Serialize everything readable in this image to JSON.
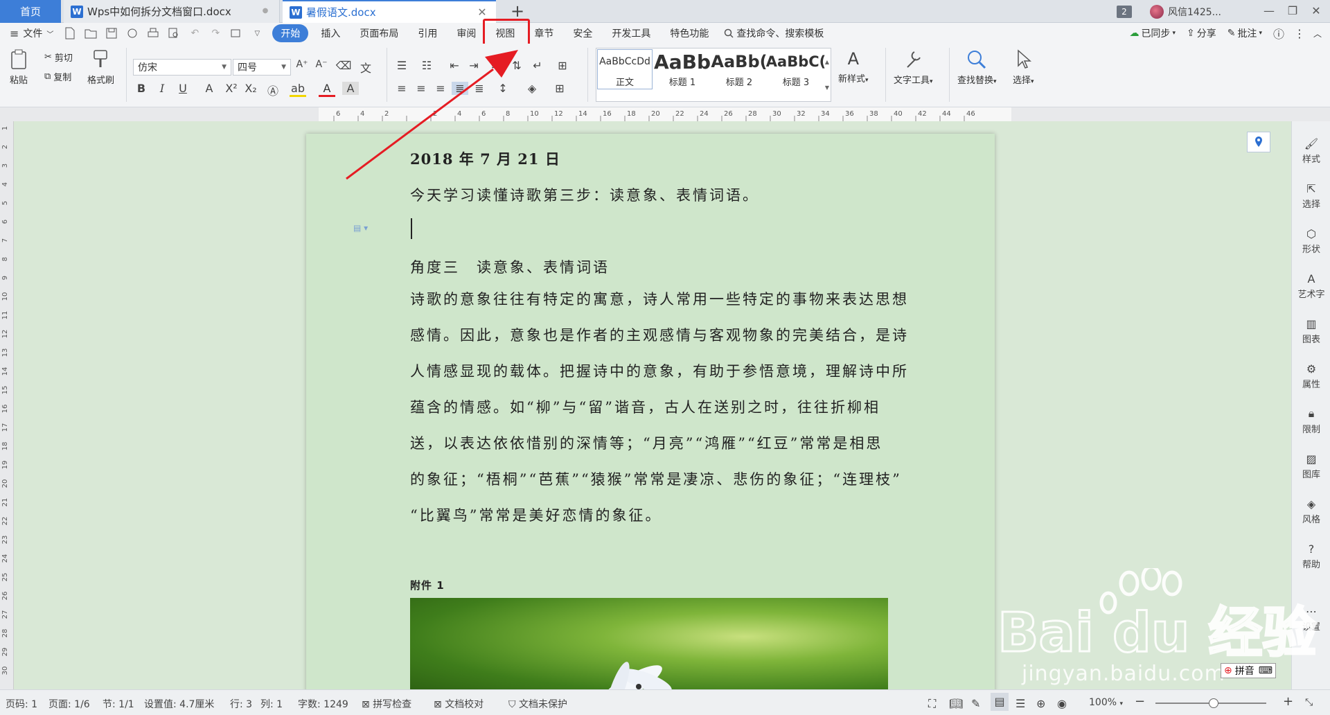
{
  "tabs": {
    "home": "首页",
    "doc1": "Wps中如何拆分文档窗口.docx",
    "doc2": "暑假语文.docx",
    "new": "+",
    "window_count": "2",
    "user": "风信1425..."
  },
  "menu": {
    "file": "文件",
    "tabs": [
      "开始",
      "插入",
      "页面布局",
      "引用",
      "审阅",
      "视图",
      "章节",
      "安全",
      "开发工具",
      "特色功能"
    ],
    "search": "查找命令、搜索模板",
    "synced": "已同步",
    "share": "分享",
    "comment": "批注"
  },
  "ribbon": {
    "paste": "粘贴",
    "cut": "剪切",
    "copy": "复制",
    "format_painter": "格式刷",
    "font_name": "仿宋",
    "font_size": "四号",
    "styles": [
      {
        "sample": "AaBbCcDd",
        "name": "正文"
      },
      {
        "sample": "AaBb",
        "name": "标题 1"
      },
      {
        "sample": "AaBb(",
        "name": "标题 2"
      },
      {
        "sample": "AaBbC(",
        "name": "标题 3"
      }
    ],
    "new_style": "新样式",
    "text_tools": "文字工具",
    "find_replace": "查找替换",
    "select": "选择"
  },
  "ruler": {
    "h_ticks": [
      "6",
      "4",
      "2",
      "",
      "2",
      "4",
      "6",
      "8",
      "10",
      "12",
      "14",
      "16",
      "18",
      "20",
      "22",
      "24",
      "26",
      "28",
      "30",
      "32",
      "34",
      "36",
      "38",
      "40",
      "42",
      "44",
      "46"
    ],
    "v_ticks": [
      "1",
      "2",
      "3",
      "4",
      "5",
      "6",
      "7",
      "8",
      "9",
      "10",
      "11",
      "12",
      "13",
      "14",
      "15",
      "16",
      "17",
      "18",
      "19",
      "20",
      "21",
      "22",
      "23",
      "24",
      "25",
      "26",
      "27",
      "28",
      "29",
      "30"
    ]
  },
  "document": {
    "date": "2018 年 7 月 21 日",
    "line1": "今天学习读懂诗歌第三步：读意象、表情词语。",
    "heading": "角度三　读意象、表情词语",
    "paragraph": [
      "诗歌的意象往往有特定的寓意，诗人常用一些特定的事物来表达思想",
      "感情。因此，意象也是作者的主观感情与客观物象的完美结合，是诗",
      "人情感显现的载体。把握诗中的意象，有助于参悟意境，理解诗中所",
      "蕴含的情感。如“柳”与“留”谐音，古人在送别之时，往往折柳相",
      "送，以表达依依惜别的深情等；“月亮”“鸿雁”“红豆”常常是相思",
      "的象征；“梧桐”“芭蕉”“猿猴”常常是凄凉、悲伤的象征；“连理枝”",
      "“比翼鸟”常常是美好恋情的象征。"
    ],
    "attachment": "附件 1"
  },
  "sidebar": [
    "样式",
    "选择",
    "形状",
    "艺术字",
    "图表",
    "属性",
    "限制",
    "图库",
    "风格",
    "帮助",
    "设置"
  ],
  "status": {
    "page_code": "页码: 1",
    "page": "页面: 1/6",
    "section": "节: 1/1",
    "setting": "设置值: 4.7厘米",
    "row": "行: 3",
    "col": "列: 1",
    "word_count": "字数: 1249",
    "spell": "拼写检查",
    "proof": "文档校对",
    "protect": "文档未保护",
    "zoom": "100%"
  },
  "watermark": {
    "text": "jingyan.baidu.com",
    "brand": "Bai du 经验"
  },
  "ime": {
    "text": "拼音"
  },
  "colors": {
    "accent": "#3d7ed8",
    "highlight": "#e51c23",
    "page": "#cfe6cb"
  }
}
